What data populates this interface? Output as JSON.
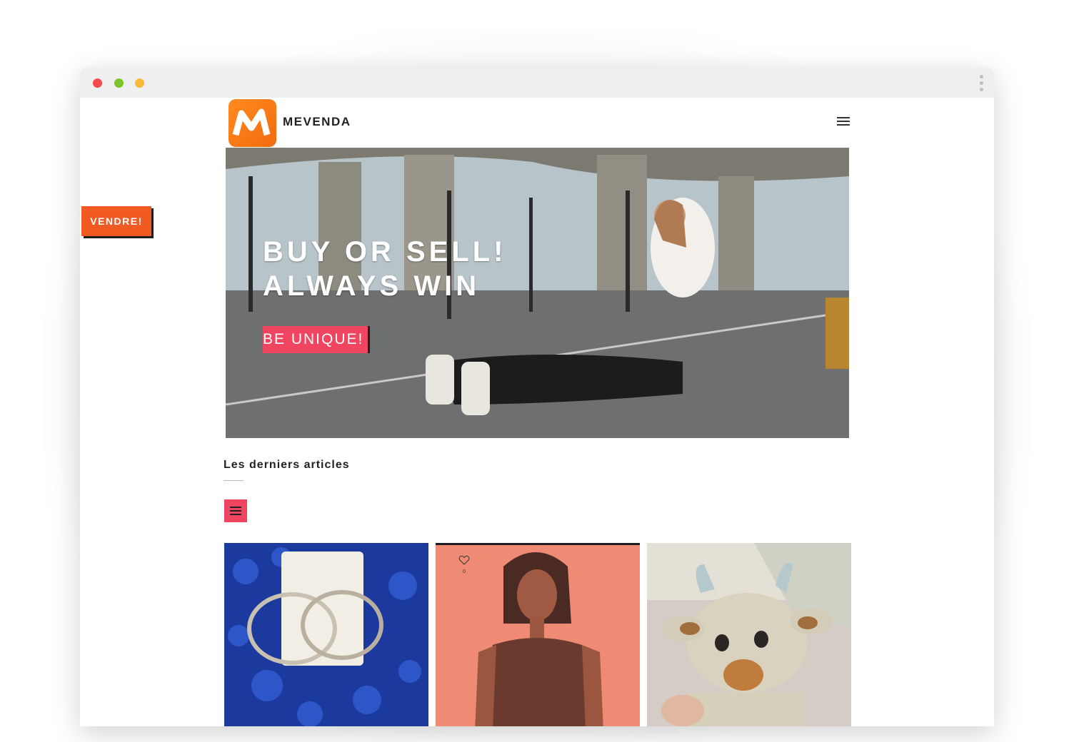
{
  "browser": {
    "traffic_lights": [
      "close",
      "minimize",
      "maximize"
    ]
  },
  "header": {
    "brand_name": "MEVENDA",
    "logo_letter": "M",
    "menu_icon": "hamburger-icon"
  },
  "side_button": {
    "label": "VENDRE!"
  },
  "hero": {
    "title_line1": "BUY OR SELL!",
    "title_line2": "ALWAYS WIN",
    "cta_label": "BE UNIQUE!"
  },
  "latest": {
    "section_title": "Les derniers articles",
    "filter_icon": "list-icon",
    "products": [
      {
        "image": "earrings-on-blue-stones",
        "favorite_count": ""
      },
      {
        "image": "woman-in-dress-on-coral",
        "favorite_count": "0"
      },
      {
        "image": "crochet-goat-toy",
        "favorite_count": ""
      }
    ]
  },
  "colors": {
    "accent_orange": "#f25a24",
    "accent_pink": "#ef4560",
    "logo_orange": "#f26b0f"
  }
}
